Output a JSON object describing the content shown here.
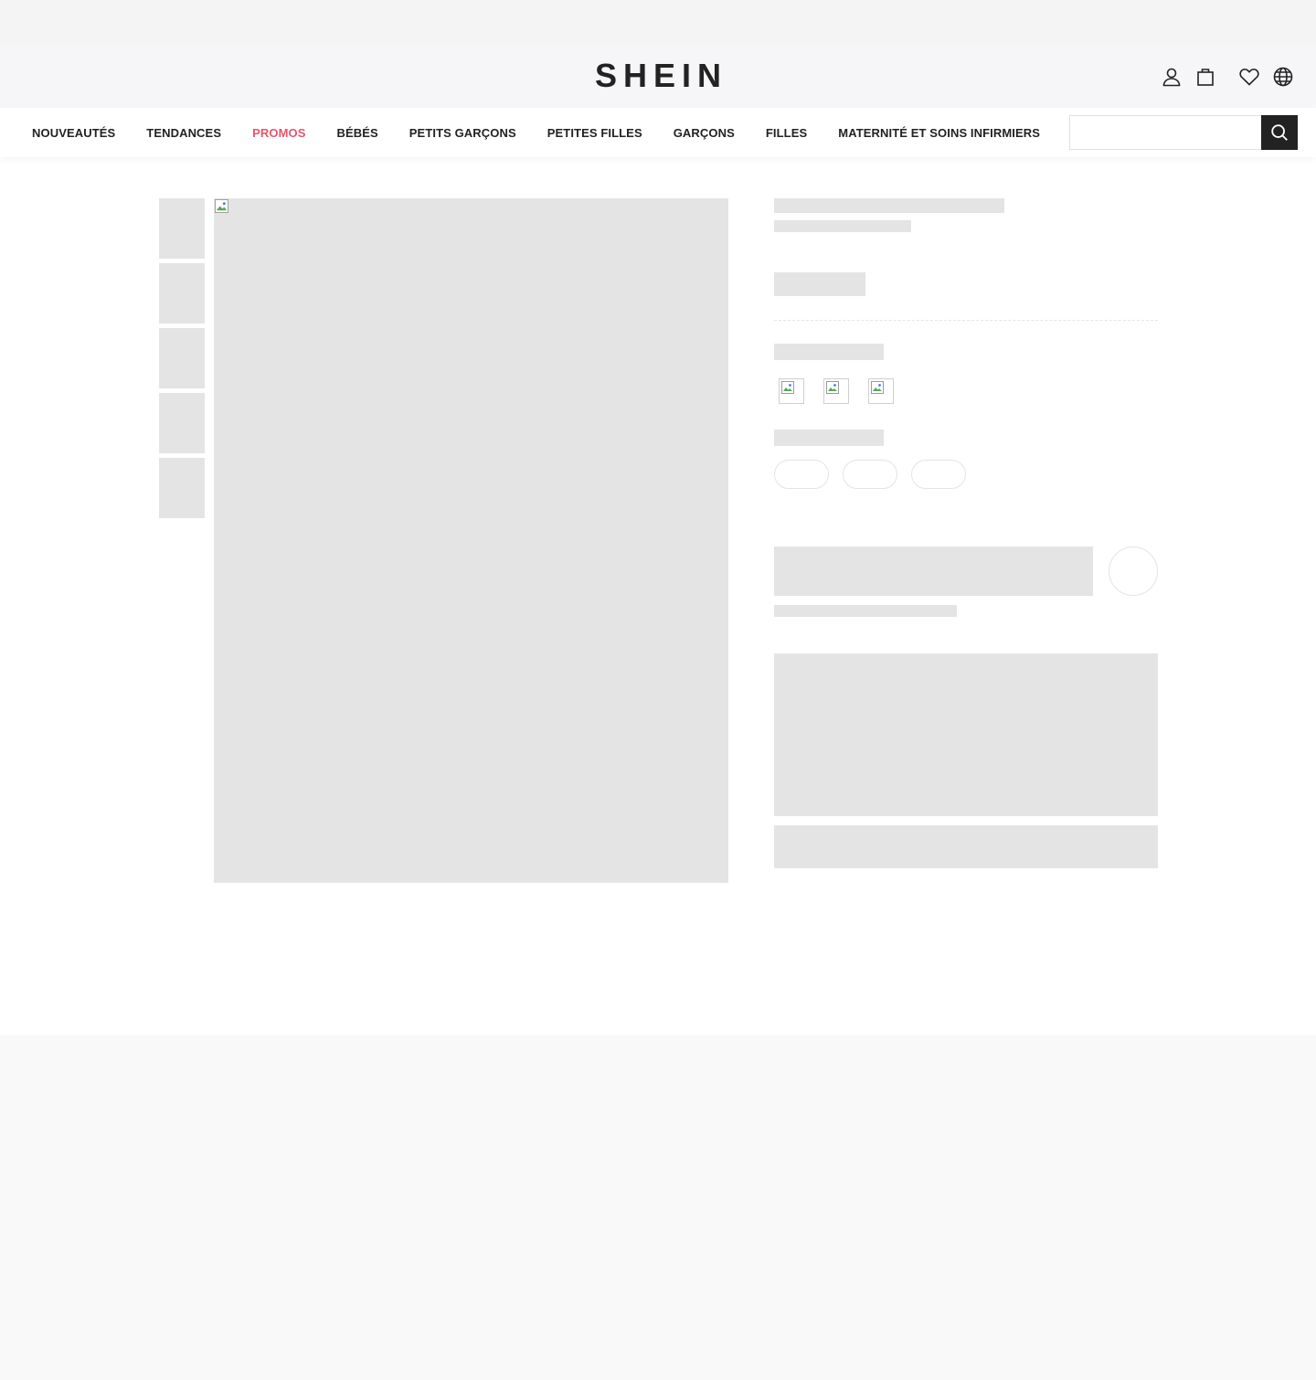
{
  "header": {
    "logo": "SHEIN",
    "icons": [
      "user-icon",
      "bag-icon",
      "heart-icon",
      "globe-icon"
    ]
  },
  "nav": {
    "items": [
      {
        "label": "NOUVEAUTÉS"
      },
      {
        "label": "TENDANCES"
      },
      {
        "label": "PROMOS"
      },
      {
        "label": "BÉBÉS"
      },
      {
        "label": "PETITS GARÇONS"
      },
      {
        "label": "PETITES FILLES"
      },
      {
        "label": "GARÇONS"
      },
      {
        "label": "FILLES"
      },
      {
        "label": "MATERNITÉ ET SOINS INFIRMIERS"
      }
    ],
    "search": {
      "placeholder": "",
      "value": ""
    }
  },
  "colors": {
    "accent_promo": "#e8556b",
    "skeleton": "#e4e4e4",
    "dark": "#222222"
  }
}
